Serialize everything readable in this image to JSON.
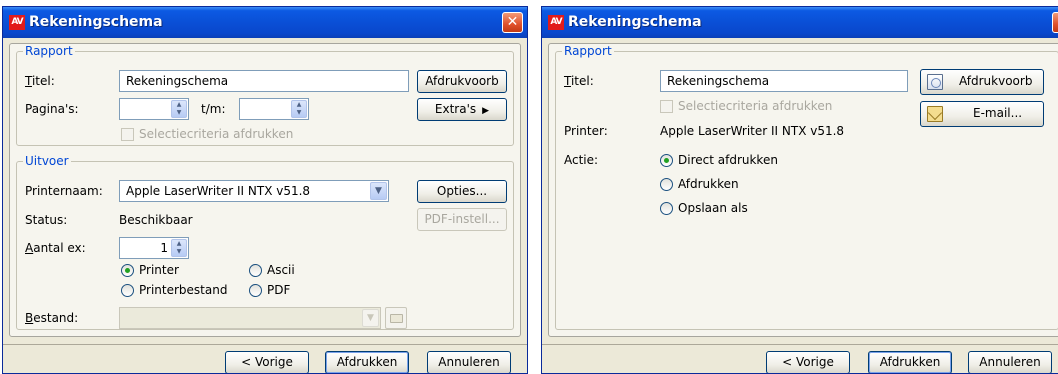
{
  "dialog1": {
    "title": "Rekeningschema",
    "logo": "AV",
    "close_glyph": "✕",
    "rapport": {
      "legend": "Rapport",
      "titel_label": "Titel:",
      "titel_value": "Rekeningschema",
      "paginas_label": "Pagina's:",
      "tm_label": "t/m:",
      "selectie_label": "Selectiecriteria afdrukken",
      "afdrukvoorb_button": "Afdrukvoorb",
      "extras_button": "Extra's"
    },
    "uitvoer": {
      "legend": "Uitvoer",
      "printernaam_label": "Printernaam:",
      "printernaam_value": "Apple LaserWriter II NTX v51.8",
      "opties_button": "Opties...",
      "status_label": "Status:",
      "status_value": "Beschikbaar",
      "pdf_button": "PDF-instell...",
      "aantal_label": "Aantal ex:",
      "aantal_value": "1",
      "radio_printer": "Printer",
      "radio_ascii": "Ascii",
      "radio_printerbestand": "Printerbestand",
      "radio_pdf": "PDF",
      "bestand_label": "Bestand:",
      "selected_output": "Printer"
    },
    "footer": {
      "vorige_button": "< Vorige",
      "afdrukken_button": "Afdrukken",
      "annuleren_button": "Annuleren"
    }
  },
  "dialog2": {
    "title": "Rekeningschema",
    "logo": "AV",
    "close_glyph": "✕",
    "rapport": {
      "legend": "Rapport",
      "titel_label": "Titel:",
      "titel_value": "Rekeningschema",
      "selectie_label": "Selectiecriteria afdrukken",
      "printer_label": "Printer:",
      "printer_value": "Apple LaserWriter II NTX v51.8",
      "actie_label": "Actie:",
      "radio_direct": "Direct afdrukken",
      "radio_afdrukken": "Afdrukken",
      "radio_opslaan": "Opslaan als",
      "selected_action": "Direct afdrukken",
      "afdrukvoorb_button": "Afdrukvoorb",
      "email_button": "E-mail..."
    },
    "footer": {
      "vorige_button": "< Vorige",
      "afdrukken_button": "Afdrukken",
      "annuleren_button": "Annuleren"
    }
  },
  "colors": {
    "titlebar": "#0a4fd6",
    "dialog_bg": "#ece9d8",
    "panel_bg": "#f6f5ee",
    "legend_text": "#0046d5",
    "close_button": "#e0502b",
    "logo_bg": "#e21b1b",
    "radio_dot": "#21a121"
  },
  "icons": {
    "logo": "av-logo-icon",
    "close": "close-icon",
    "spin": "spin-arrows-icon",
    "dropdown": "chevron-down-icon",
    "extras": "triangle-right-icon",
    "browse": "folder-icon",
    "preview": "print-preview-icon",
    "email": "email-envelope-icon"
  }
}
